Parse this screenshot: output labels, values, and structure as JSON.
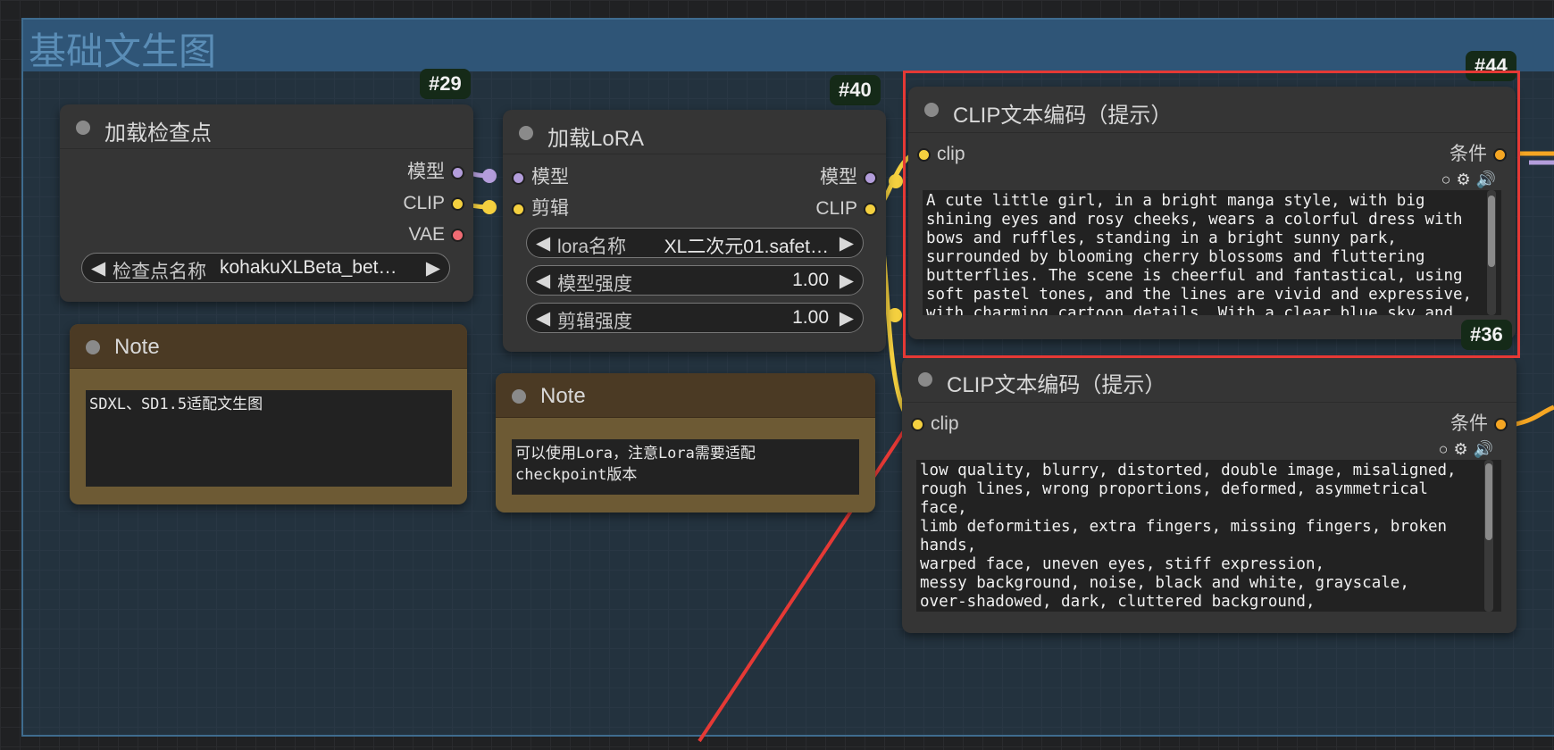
{
  "group": {
    "title": "基础文生图"
  },
  "checkpoint_node": {
    "badge": "#29",
    "title": "加载检查点",
    "outputs": [
      "模型",
      "CLIP",
      "VAE"
    ],
    "widget": {
      "name": "检查点名称",
      "value": "kohakuXLBeta_bet…"
    }
  },
  "lora_node": {
    "badge": "#40",
    "title": "加载LoRA",
    "inputs": [
      "模型",
      "剪辑"
    ],
    "outputs": [
      "模型",
      "CLIP"
    ],
    "widgets": [
      {
        "name": "lora名称",
        "value": "XL二次元01.safet…"
      },
      {
        "name": "模型强度",
        "value": "1.00"
      },
      {
        "name": "剪辑强度",
        "value": "1.00"
      }
    ]
  },
  "note1": {
    "title": "Note",
    "text": "SDXL、SD1.5适配文生图"
  },
  "note2": {
    "title": "Note",
    "text": "可以使用Lora，注意Lora需要适配\ncheckpoint版本"
  },
  "clip_pos": {
    "badge": "#44",
    "title": "CLIP文本编码（提示）",
    "input": "clip",
    "output": "条件",
    "text": "A cute little girl, in a bright manga style, with big\nshining eyes and rosy cheeks, wears a colorful dress with\nbows and ruffles, standing in a bright sunny park,\nsurrounded by blooming cherry blossoms and fluttering\nbutterflies. The scene is cheerful and fantastical, using\nsoft pastel tones, and the lines are vivid and expressive,\nwith charming cartoon details. With a clear blue sky and"
  },
  "clip_neg": {
    "badge": "#36",
    "title": "CLIP文本编码（提示）",
    "input": "clip",
    "output": "条件",
    "text": "low quality, blurry, distorted, double image, misaligned,\nrough lines, wrong proportions, deformed, asymmetrical\nface,\nlimb deformities, extra fingers, missing fingers, broken\nhands,\nwarped face, uneven eyes, stiff expression,\nmessy background, noise, black and white, grayscale,\nover-shadowed, dark, cluttered background,"
  },
  "icons": [
    "circle-icon",
    "gear-icon",
    "speaker-icon"
  ],
  "colors": {
    "model_slot": "#b39ddb",
    "clip_slot": "#f4d03f",
    "vae_slot": "#ef6b73",
    "conditioning_slot": "#f5a623",
    "group": "#3f6c8f",
    "highlight": "#e53935"
  }
}
